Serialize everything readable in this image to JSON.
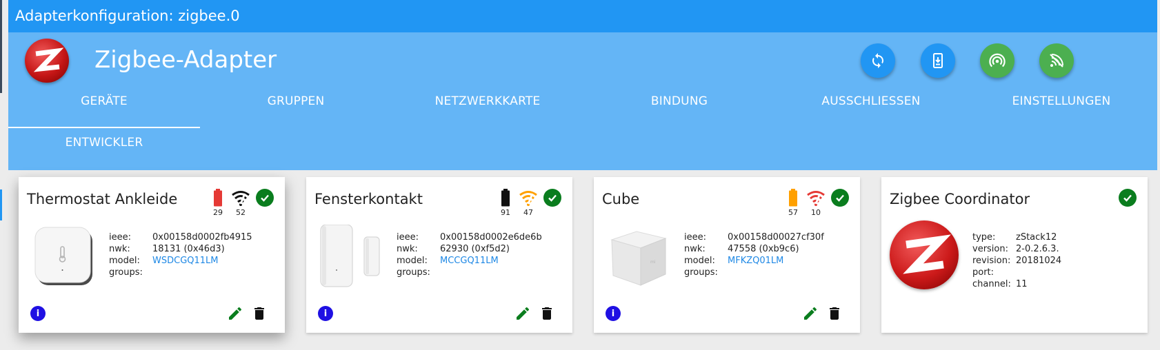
{
  "window": {
    "title": "Adapterkonfiguration: zigbee.0"
  },
  "app": {
    "title": "Zigbee-Adapter"
  },
  "tabs": [
    {
      "label": "GERÄTE"
    },
    {
      "label": "GRUPPEN"
    },
    {
      "label": "NETZWERKKARTE"
    },
    {
      "label": "BINDUNG"
    },
    {
      "label": "AUSSCHLIESSEN"
    },
    {
      "label": "EINSTELLUNGEN"
    },
    {
      "label": "ENTWICKLER"
    }
  ],
  "colors": {
    "titlebar": "#2196f3",
    "header": "#64b5f6",
    "battery_low": "#e53935",
    "battery_full": "#111111",
    "battery_mid": "#ffa000",
    "signal_good": "#111111",
    "signal_mid": "#ffa000",
    "signal_bad": "#e53935",
    "ok": "#0a7d1e",
    "link": "#1e88e5"
  },
  "devices": [
    {
      "name": "Thermostat Ankleide",
      "battery": "29",
      "signal": "52",
      "ieee": "0x00158d0002fb4915",
      "nwk": "18131 (0x46d3)",
      "model": "WSDCGQ11LM",
      "groups": ""
    },
    {
      "name": "Fensterkontakt",
      "battery": "91",
      "signal": "47",
      "ieee": "0x00158d0002e6de6b",
      "nwk": "62930 (0xf5d2)",
      "model": "MCCGQ11LM",
      "groups": ""
    },
    {
      "name": "Cube",
      "battery": "57",
      "signal": "10",
      "ieee": "0x00158d00027cf30f",
      "nwk": "47558 (0xb9c6)",
      "model": "MFKZQ01LM",
      "groups": ""
    }
  ],
  "labels": {
    "ieee": "ieee:",
    "nwk": "nwk:",
    "model": "model:",
    "groups": "groups:",
    "type": "type:",
    "version": "version:",
    "revision": "revision:",
    "port": "port:",
    "channel": "channel:",
    "info": "i"
  },
  "coordinator": {
    "name": "Zigbee Coordinator",
    "type": "zStack12",
    "version": "2-0.2.6.3.",
    "revision": "20181024",
    "port": "",
    "channel": "11"
  },
  "icons": {
    "header_actions": [
      "refresh-icon",
      "device-download-icon",
      "wifi-pairing-icon",
      "signal-off-icon"
    ],
    "card_actions": [
      "info-icon",
      "edit-icon",
      "delete-icon"
    ]
  }
}
